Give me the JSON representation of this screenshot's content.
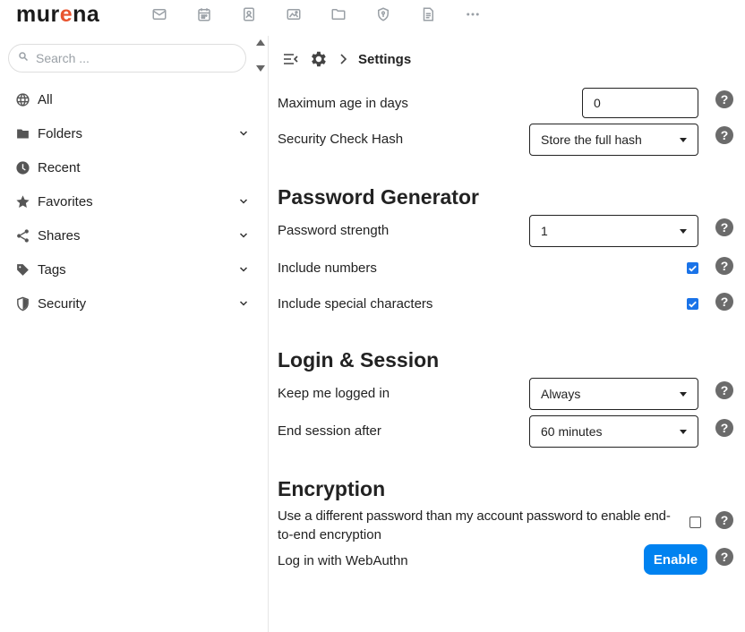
{
  "brand": {
    "logo_left": "mur",
    "logo_o": "e",
    "logo_right": "na"
  },
  "apps": [
    {
      "name": "mail-icon"
    },
    {
      "name": "calendar-icon"
    },
    {
      "name": "contacts-icon"
    },
    {
      "name": "photos-icon"
    },
    {
      "name": "files-icon"
    },
    {
      "name": "passwords-icon"
    },
    {
      "name": "notes-icon"
    },
    {
      "name": "more-icon"
    }
  ],
  "search": {
    "placeholder": "Search ..."
  },
  "sidebar": {
    "items": [
      {
        "label": "All",
        "icon": "globe-icon",
        "expandable": false
      },
      {
        "label": "Folders",
        "icon": "folder-icon",
        "expandable": true
      },
      {
        "label": "Recent",
        "icon": "clock-icon",
        "expandable": false
      },
      {
        "label": "Favorites",
        "icon": "star-icon",
        "expandable": true
      },
      {
        "label": "Shares",
        "icon": "share-icon",
        "expandable": true
      },
      {
        "label": "Tags",
        "icon": "tag-icon",
        "expandable": true
      },
      {
        "label": "Security",
        "icon": "shield-icon",
        "expandable": true
      }
    ]
  },
  "header": {
    "title": "Settings"
  },
  "settings": {
    "max_age_label": "Maximum age in days",
    "max_age_value": "0",
    "hash_label": "Security Check Hash",
    "hash_value": "Store the full hash",
    "pg_title": "Password Generator",
    "strength_label": "Password strength",
    "strength_value": "1",
    "numbers_label": "Include numbers",
    "numbers_checked": true,
    "special_label": "Include special characters",
    "special_checked": true,
    "ls_title": "Login & Session",
    "keep_label": "Keep me logged in",
    "keep_value": "Always",
    "end_label": "End session after",
    "end_value": "60 minutes",
    "enc_title": "Encryption",
    "enc_line1": "Use a different password than my account password to enable end-",
    "enc_line2": "to-end encryption",
    "enc_checked": false,
    "webauthn_label": "Log in with WebAuthn",
    "enable_label": "Enable",
    "help_glyph": "?"
  },
  "colors": {
    "accent": "#0082f0",
    "brand_o": "#e8542f",
    "checkbox": "#1a73e8"
  }
}
